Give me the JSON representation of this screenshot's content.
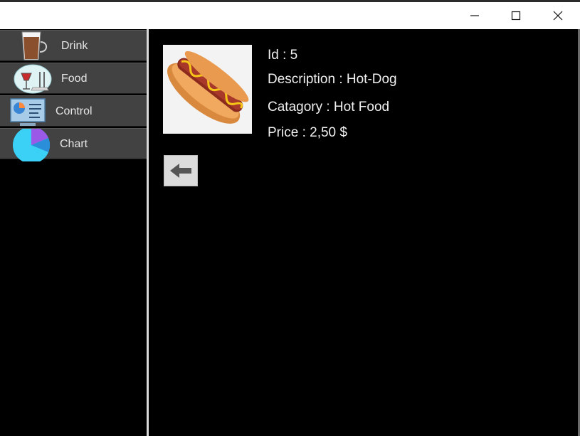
{
  "window": {
    "controls": {
      "minimize": "minimize-icon",
      "maximize": "maximize-icon",
      "close": "close-icon"
    }
  },
  "sidebar": {
    "items": [
      {
        "label": "Drink",
        "icon": "drink-glass-icon"
      },
      {
        "label": "Food",
        "icon": "food-plate-icon"
      },
      {
        "label": "Control",
        "icon": "control-panel-icon"
      },
      {
        "label": "Chart",
        "icon": "pie-chart-icon"
      }
    ]
  },
  "product": {
    "image": "hot-dog-image",
    "id_text": "Id : 5",
    "description_text": "Description : Hot-Dog",
    "category_text": "Catagory : Hot Food",
    "price_text": "Price : 2,50 $"
  },
  "back_button": {
    "icon": "back-arrow-icon"
  },
  "colors": {
    "sidebar_item_bg": "#424242",
    "background": "#000000",
    "divider": "#d9d9d9"
  }
}
